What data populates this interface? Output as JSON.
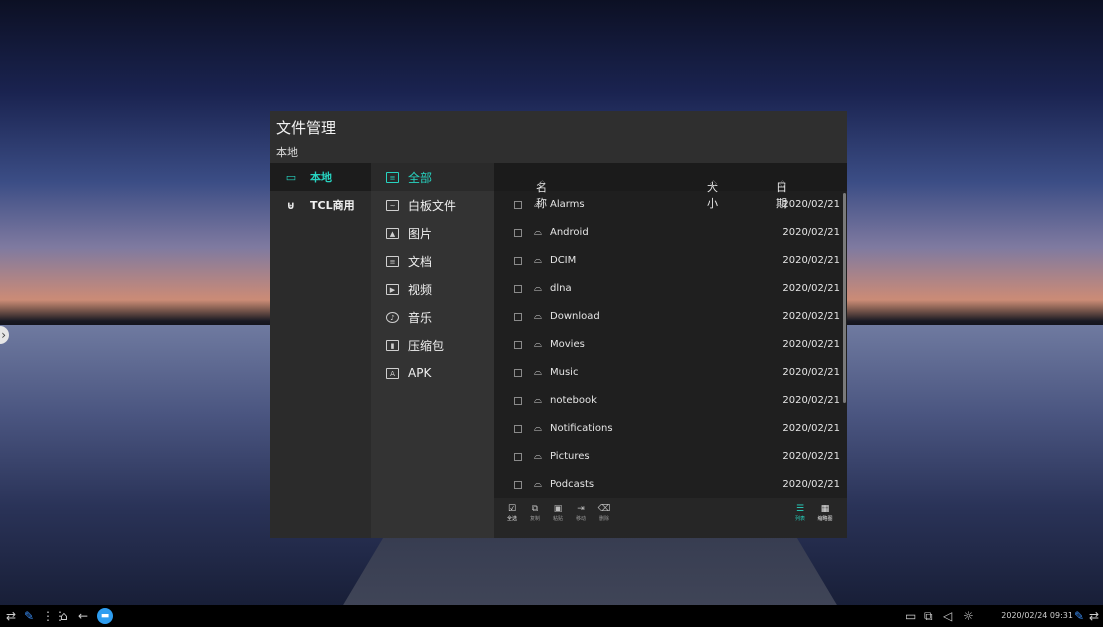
{
  "window": {
    "title": "文件管理",
    "path": "本地"
  },
  "sources": [
    {
      "label": "本地",
      "icon": "monitor-icon",
      "active": true
    },
    {
      "label": "TCL商用",
      "icon": "usb-icon",
      "active": false
    }
  ],
  "categories": [
    {
      "label": "全部",
      "icon": "all-files-icon",
      "active": true
    },
    {
      "label": "白板文件",
      "icon": "whiteboard-icon",
      "active": false
    },
    {
      "label": "图片",
      "icon": "image-icon",
      "active": false
    },
    {
      "label": "文档",
      "icon": "document-icon",
      "active": false
    },
    {
      "label": "视频",
      "icon": "video-icon",
      "active": false
    },
    {
      "label": "音乐",
      "icon": "music-icon",
      "active": false
    },
    {
      "label": "压缩包",
      "icon": "archive-icon",
      "active": false
    },
    {
      "label": "APK",
      "icon": "apk-icon",
      "active": false
    }
  ],
  "file_table": {
    "columns": {
      "name": "名称",
      "size": "大小",
      "date": "日期"
    },
    "rows": [
      {
        "name": "Alarms",
        "date": "2020/02/21"
      },
      {
        "name": "Android",
        "date": "2020/02/21"
      },
      {
        "name": "DCIM",
        "date": "2020/02/21"
      },
      {
        "name": "dlna",
        "date": "2020/02/21"
      },
      {
        "name": "Download",
        "date": "2020/02/21"
      },
      {
        "name": "Movies",
        "date": "2020/02/21"
      },
      {
        "name": "Music",
        "date": "2020/02/21"
      },
      {
        "name": "notebook",
        "date": "2020/02/21"
      },
      {
        "name": "Notifications",
        "date": "2020/02/21"
      },
      {
        "name": "Pictures",
        "date": "2020/02/21"
      },
      {
        "name": "Podcasts",
        "date": "2020/02/21"
      }
    ]
  },
  "toolbar": {
    "select_all": "全选",
    "copy": "复制",
    "paste": "粘贴",
    "move": "移动",
    "delete": "删除",
    "list_view": "列表",
    "thumbnail_view": "缩略图"
  },
  "taskbar": {
    "datetime": "2020/02/24  09:31"
  },
  "colors": {
    "accent": "#27d3c0",
    "taskbar_app": "#2e9df0"
  }
}
